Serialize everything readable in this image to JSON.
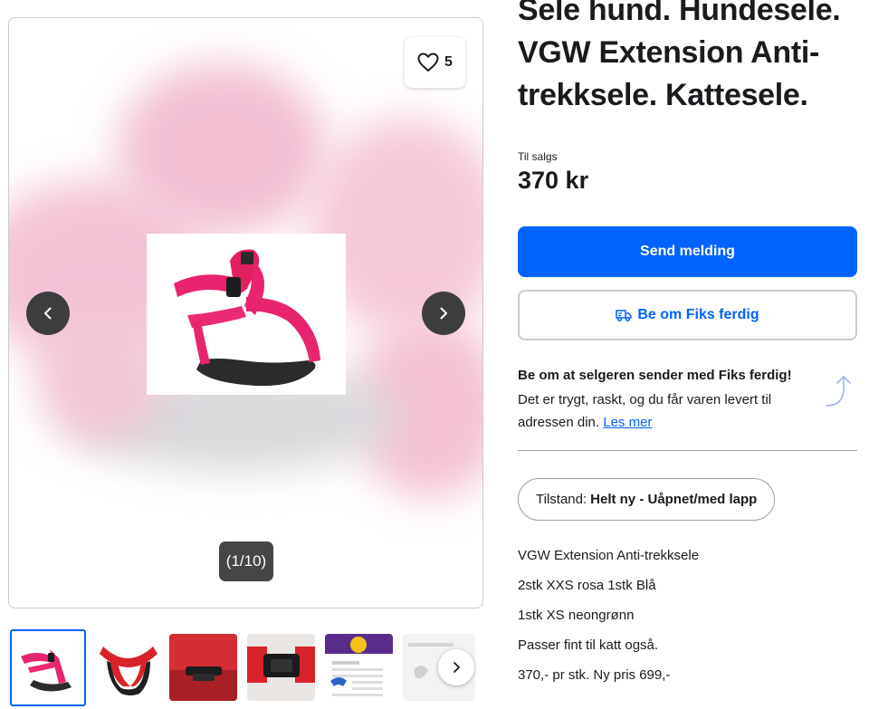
{
  "listing": {
    "title": "Sele hund. Hundesele. VGW Extension Anti-trekksele. Kattesele.",
    "status": "Til salgs",
    "price": "370 kr"
  },
  "gallery": {
    "favorite_count": "5",
    "counter": "(1/10)",
    "thumbnail_count": 6,
    "icons": {
      "favorite": "heart-icon",
      "prev": "chevron-left-icon",
      "next": "chevron-right-icon",
      "thumb_next": "chevron-right-icon"
    }
  },
  "actions": {
    "send_message": "Send melding",
    "fiks_ferdig": "Be om Fiks ferdig",
    "fiks_icon": "delivery-truck-icon"
  },
  "promo": {
    "title": "Be om at selgeren sender med Fiks ferdig!",
    "text": "Det er trygt, raskt, og du får varen levert til adressen din.",
    "link": "Les mer",
    "icon": "curved-arrow-icon"
  },
  "condition": {
    "label": "Tilstand:",
    "value": "Helt ny - Uåpnet/med lapp"
  },
  "description": [
    "VGW Extension Anti-trekksele",
    "2stk XXS rosa 1stk Blå",
    "1stk XS neongrønn",
    "Passer fint til katt også.",
    "370,- pr stk. Ny pris 699,-"
  ],
  "colors": {
    "accent": "#0063fb",
    "harness_pink": "#e8246e",
    "text": "#1b1b1f",
    "border": "#c9cbd0"
  }
}
